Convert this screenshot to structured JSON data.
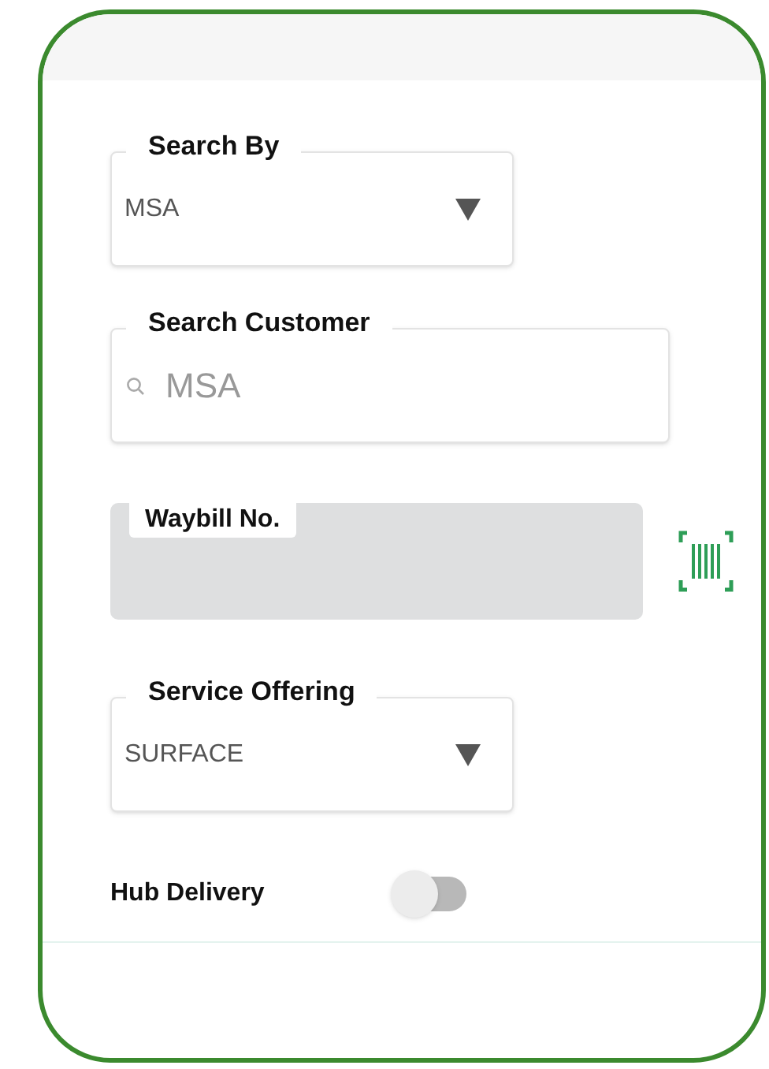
{
  "form": {
    "fields": [
      {
        "kind": "dropdown",
        "label": "Search By",
        "value": "MSA"
      },
      {
        "kind": "search",
        "label": "Search Customer",
        "placeholder": "MSA"
      },
      {
        "kind": "scan",
        "label": "Waybill No.",
        "disabled": true
      },
      {
        "kind": "dropdown",
        "label": "Service Offering",
        "value": "SURFACE"
      }
    ],
    "hub_delivery": {
      "label": "Hub Delivery",
      "on": false
    }
  }
}
